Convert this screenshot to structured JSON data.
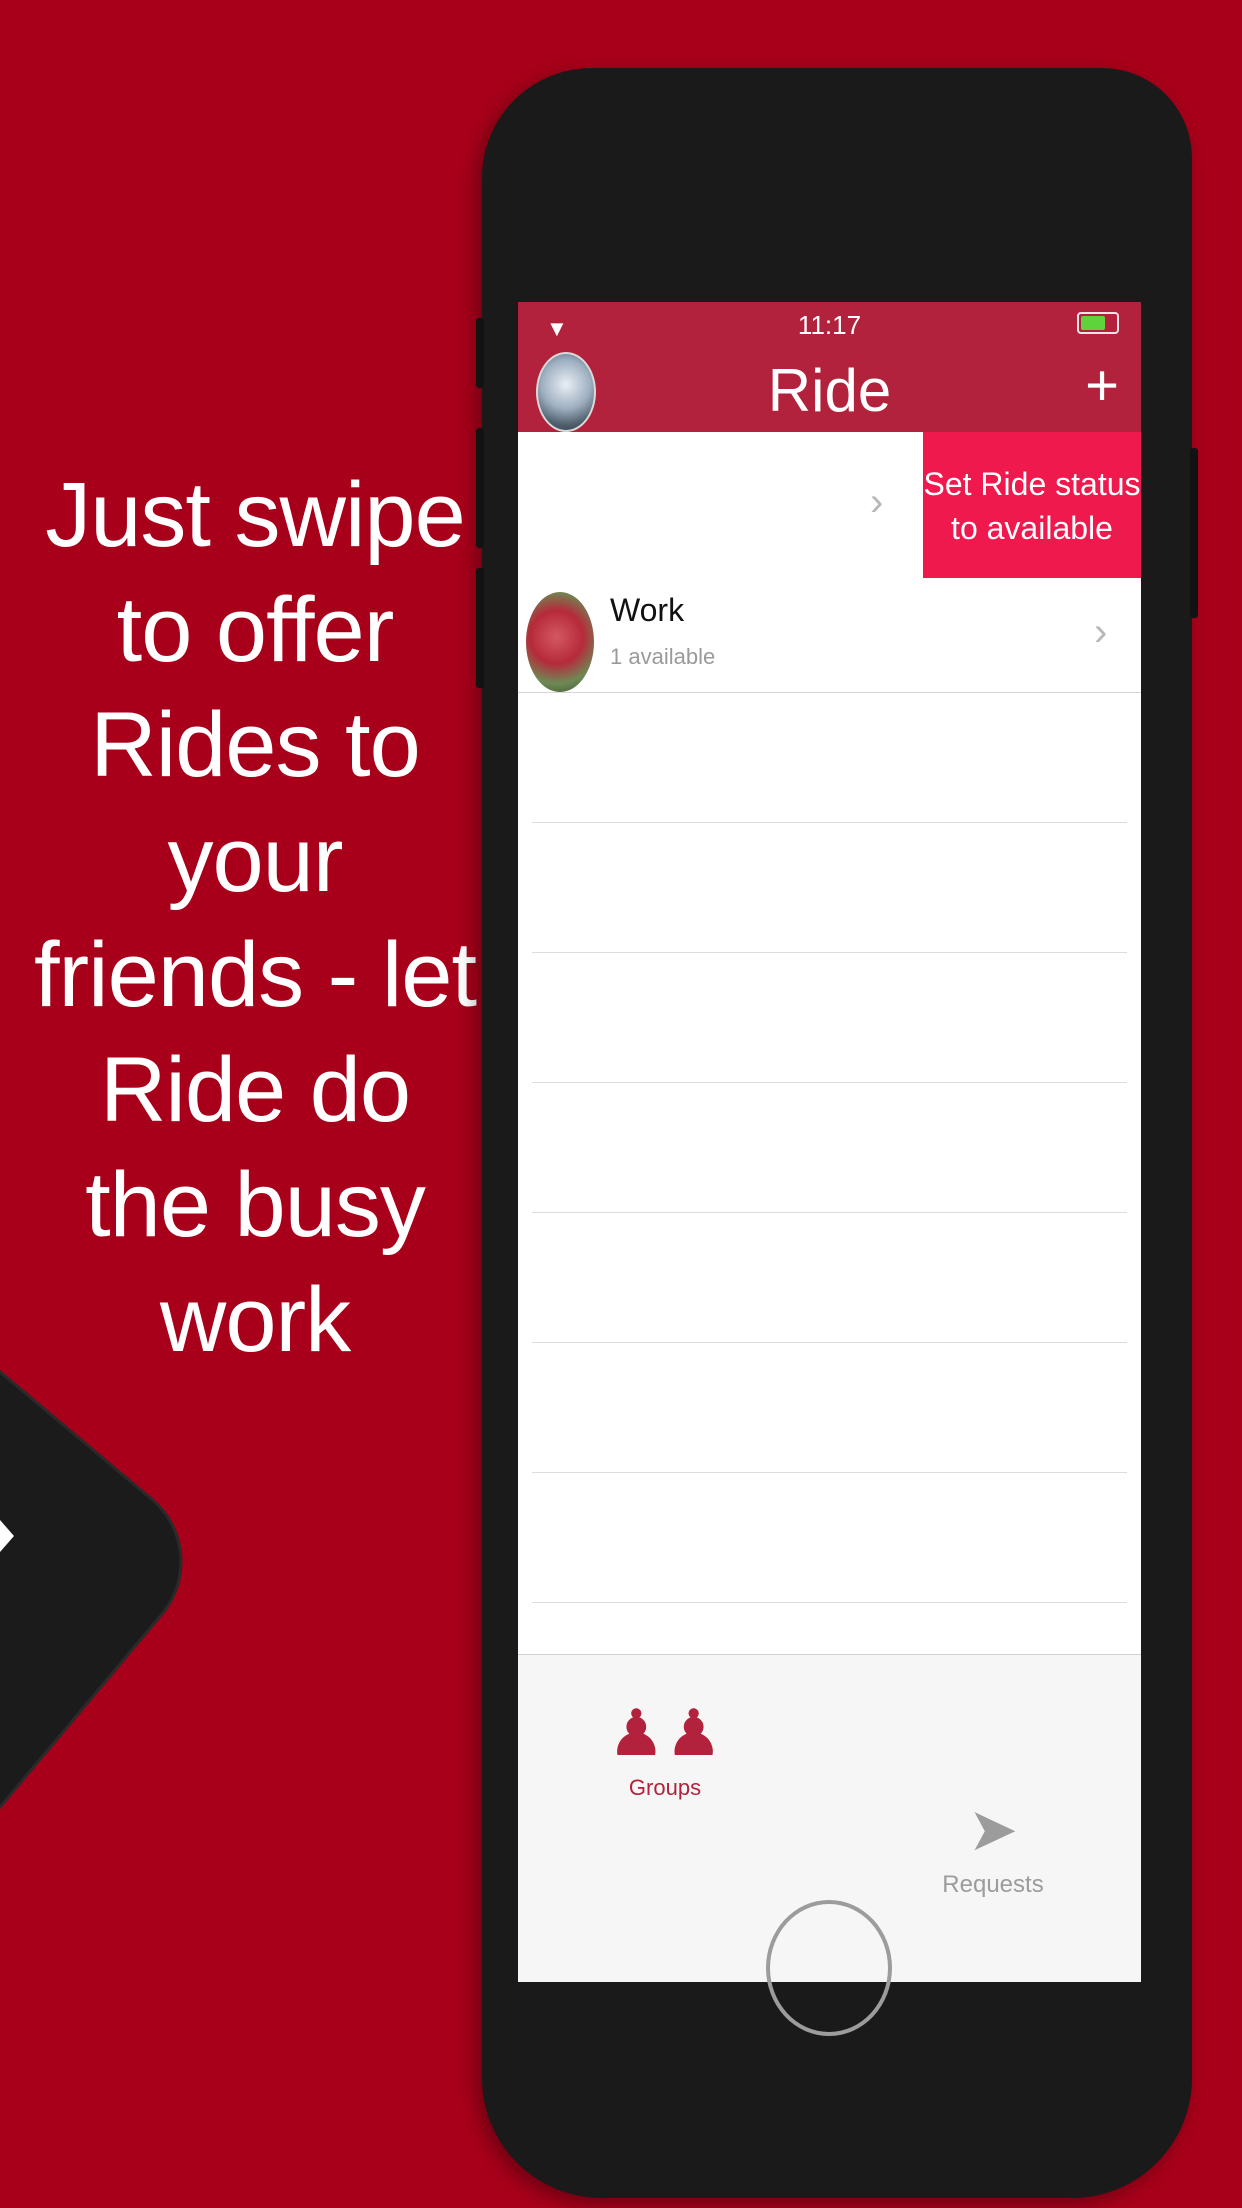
{
  "marketing": {
    "lines": [
      "Just swipe",
      "to offer",
      "Rides to",
      "your",
      "friends - let",
      "Ride do",
      "the busy",
      "work"
    ]
  },
  "status_bar": {
    "time": "11:17",
    "wifi_icon": "wifi-icon",
    "battery_icon": "battery-charging-icon"
  },
  "nav": {
    "title": "Ride",
    "add_label": "+",
    "avatar_icon": "profile-avatar"
  },
  "rows": [
    {
      "name": "",
      "subtitle": "",
      "action_label_1": "Set Ride status",
      "action_label_2": "to available"
    },
    {
      "name": "Work",
      "subtitle": "1 available"
    }
  ],
  "chevron": "›",
  "tabbar": {
    "groups_label": "Groups",
    "requests_label": "Requests",
    "groups_icon": "people-icon",
    "requests_icon": "paper-plane-icon",
    "active_color": "#b3223c",
    "inactive_color": "#9c9c9c"
  },
  "colors": {
    "background": "#a8001a",
    "nav": "#b3223c",
    "swipe_action": "#f0194e"
  }
}
